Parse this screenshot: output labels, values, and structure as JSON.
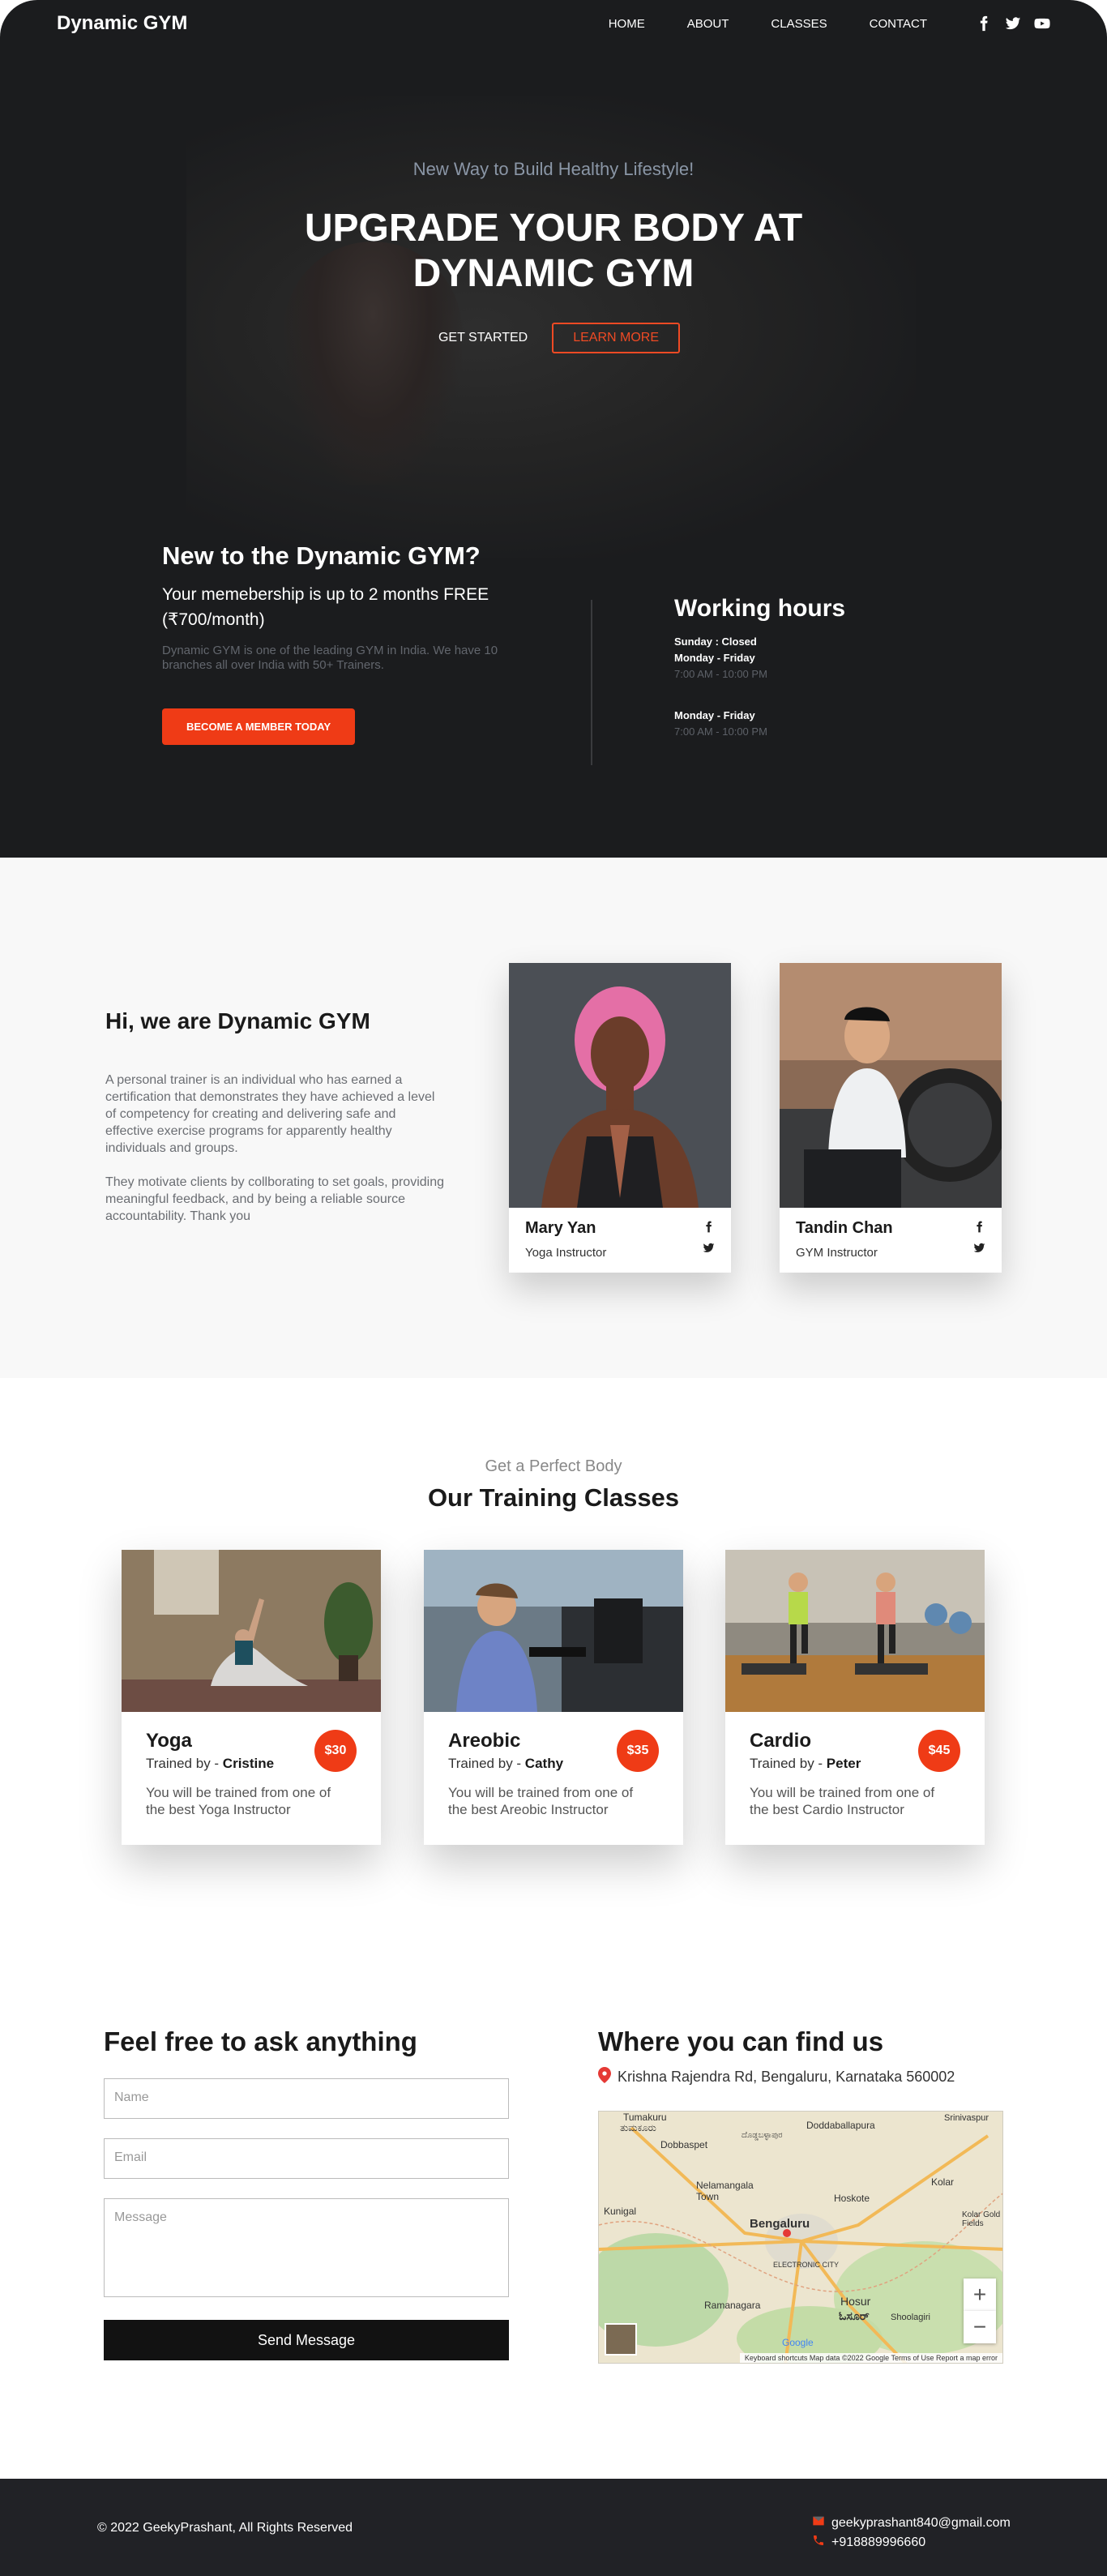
{
  "nav": {
    "brand": "Dynamic GYM",
    "links": [
      "HOME",
      "ABOUT",
      "CLASSES",
      "CONTACT"
    ],
    "social_icons": [
      "facebook-icon",
      "twitter-icon",
      "youtube-icon"
    ]
  },
  "hero": {
    "subtitle": "New Way to Build Healthy Lifestyle!",
    "title": "UPGRADE YOUR BODY AT DYNAMIC GYM",
    "get_started": "GET STARTED",
    "learn_more": "LEARN MORE"
  },
  "promo": {
    "heading": "New to the Dynamic GYM?",
    "lead": "Your memebership is up to 2 months FREE (₹700/month)",
    "text": "Dynamic GYM is one of the leading GYM in India. We have 10 branches all over India with 50+ Trainers.",
    "button": "BECOME A MEMBER TODAY"
  },
  "hours": {
    "heading": "Working hours",
    "sunday": "Sunday : Closed",
    "row1_day": "Monday - Friday",
    "row1_time": "7:00 AM - 10:00 PM",
    "row2_day": "Monday - Friday",
    "row2_time": "7:00 AM - 10:00 PM"
  },
  "about": {
    "heading": "Hi, we are Dynamic GYM",
    "para1": "A personal trainer is an individual who has earned a certification that demonstrates they have achieved a level of competency for creating and delivering safe and effective exercise programs for apparently healthy individuals and groups.",
    "para2": "They motivate clients by collborating to set goals, providing meaningful feedback, and by being a reliable source accountability. Thank you",
    "trainers": [
      {
        "name": "Mary Yan",
        "role": "Yoga Instructor"
      },
      {
        "name": "Tandin Chan",
        "role": "GYM Instructor"
      }
    ]
  },
  "classes": {
    "subtitle": "Get a Perfect Body",
    "title": "Our Training Classes",
    "trained_by": "Trained by - ",
    "items": [
      {
        "name": "Yoga",
        "trainer": "Cristine",
        "price": "$30",
        "desc": "You will be trained from one of the best Yoga Instructor"
      },
      {
        "name": "Areobic",
        "trainer": "Cathy",
        "price": "$35",
        "desc": "You will be trained from one of the best Areobic Instructor"
      },
      {
        "name": "Cardio",
        "trainer": "Peter",
        "price": "$45",
        "desc": "You will be trained from one of the best Cardio Instructor"
      }
    ]
  },
  "contact": {
    "heading": "Feel free to ask anything",
    "name_placeholder": "Name",
    "email_placeholder": "Email",
    "message_placeholder": "Message",
    "send": "Send Message"
  },
  "location": {
    "heading": "Where you can find us",
    "address": "Krishna Rajendra Rd, Bengaluru, Karnataka 560002",
    "map_labels": [
      "Tumakuru",
      "ತುಮಕೂರು",
      "Doddaballapura",
      "ದೊಡ್ಡಬಳ್ಳಾಪುರ",
      "Dobbaspet",
      "Nelamangala Town",
      "Kunigal",
      "Bengaluru",
      "Hoskote",
      "Kolar",
      "Srinivaspur",
      "ELECTRONIC CITY",
      "Ramanagara",
      "Hosur",
      "ಓಸೂರ್",
      "Shoolagiri",
      "Kolar Gold Fields"
    ],
    "attribution": "Keyboard shortcuts   Map data ©2022 Google   Terms of Use   Report a map error",
    "google": "Google"
  },
  "footer": {
    "copyright": "© 2022 GeekyPrashant, All Rights Reserved",
    "email": "geekyprashant840@gmail.com",
    "phone": "+918889996660"
  },
  "colors": {
    "accent": "#ef3b16",
    "dark": "#1b1c1e",
    "footer": "#212226"
  }
}
